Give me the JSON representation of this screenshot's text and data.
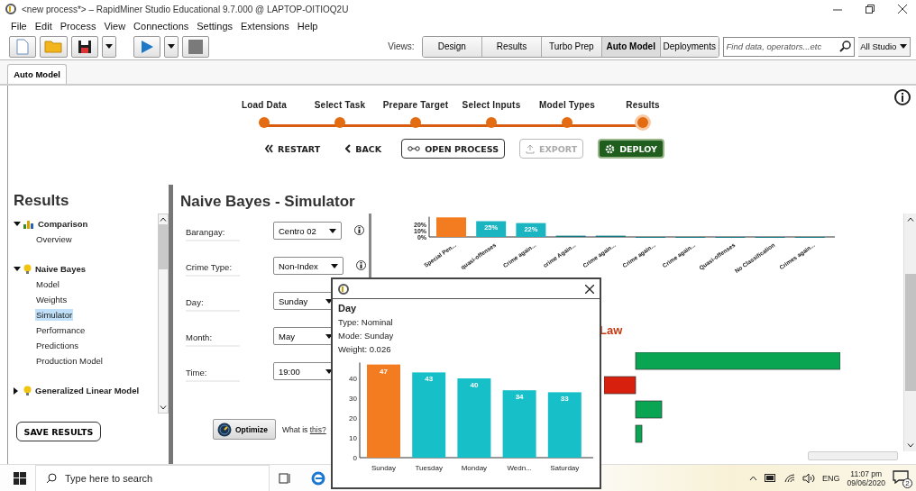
{
  "window": {
    "title": "<new process*> – RapidMiner Studio Educational 9.7.000 @ LAPTOP-OITIOQ2U"
  },
  "menu": [
    "File",
    "Edit",
    "Process",
    "View",
    "Connections",
    "Settings",
    "Extensions",
    "Help"
  ],
  "toolbar": {
    "views_label": "Views:",
    "views": [
      {
        "label": "Design",
        "selected": false
      },
      {
        "label": "Results",
        "selected": false
      },
      {
        "label": "Turbo Prep",
        "selected": false
      },
      {
        "label": "Auto Model",
        "selected": true
      },
      {
        "label": "Deployments",
        "selected": false
      }
    ],
    "search": {
      "placeholder": "Find data, operators...etc"
    },
    "scope": "All Studio"
  },
  "tabs": [
    {
      "label": "Auto Model",
      "selected": true
    }
  ],
  "stepper": {
    "steps": [
      {
        "label": "Load Data",
        "selected": false
      },
      {
        "label": "Select Task",
        "selected": false
      },
      {
        "label": "Prepare Target",
        "selected": false
      },
      {
        "label": "Select Inputs",
        "selected": false
      },
      {
        "label": "Model Types",
        "selected": false
      },
      {
        "label": "Results",
        "selected": true
      }
    ],
    "buttons": [
      {
        "label": "RESTART",
        "kind": "restart",
        "disabled": false
      },
      {
        "label": "BACK",
        "kind": "back",
        "disabled": false
      },
      {
        "label": "OPEN PROCESS",
        "kind": "open",
        "disabled": false
      },
      {
        "label": "EXPORT",
        "kind": "export",
        "disabled": true
      },
      {
        "label": "DEPLOY",
        "kind": "deploy",
        "disabled": false
      }
    ]
  },
  "results": {
    "title": "Results",
    "tree": [
      {
        "label": "Comparison",
        "kind": "comparison",
        "expanded": true,
        "children": [
          {
            "label": "Overview",
            "selected": false
          }
        ]
      },
      {
        "label": "Naive Bayes",
        "kind": "model",
        "expanded": true,
        "children": [
          {
            "label": "Model",
            "selected": false
          },
          {
            "label": "Weights",
            "selected": false
          },
          {
            "label": "Simulator",
            "selected": true
          },
          {
            "label": "Performance",
            "selected": false
          },
          {
            "label": "Predictions",
            "selected": false
          },
          {
            "label": "Production Model",
            "selected": false
          }
        ]
      },
      {
        "label": "Generalized Linear Model",
        "kind": "model",
        "expanded": false
      }
    ],
    "save_button": "SAVE RESULTS"
  },
  "simulator": {
    "title": "Naive Bayes - Simulator",
    "fields": [
      {
        "label": "Barangay:",
        "value": "Centro 02",
        "info": true
      },
      {
        "label": "Crime Type:",
        "value": "Non-Index",
        "info": true
      },
      {
        "label": "Day:",
        "value": "Sunday",
        "info": false
      },
      {
        "label": "Month:",
        "value": "May",
        "info": false
      },
      {
        "label": "Time:",
        "value": "19:00",
        "info": false
      }
    ],
    "optimize": "Optimize",
    "help_text": "What is",
    "help_link": "this?"
  },
  "prediction_chart": {
    "bars": [
      {
        "color": "#f47c20"
      },
      {
        "color": "#1ab5c0"
      },
      {
        "color": "#1ab5c0"
      },
      {
        "color": "#137c85"
      },
      {
        "color": "#137c85"
      },
      {
        "color": "#137c85"
      },
      {
        "color": "#137c85"
      },
      {
        "color": "#137c85"
      },
      {
        "color": "#137c85"
      },
      {
        "color": "#137c85"
      }
    ],
    "chart_data": {
      "type": "bar",
      "categories": [
        "Special Pen...",
        "quasi-offenses",
        "Crime again...",
        "crime Again...",
        "Crime again...",
        "Crime again...",
        "Crime again...",
        "Quasi-offenses",
        "No Classification",
        "Crimes again..."
      ],
      "values": [
        31,
        25,
        22,
        2,
        2,
        0,
        0,
        0,
        0,
        0
      ],
      "ylim": [
        0,
        32
      ],
      "yticks": [
        {
          "value": 0,
          "label": "0%"
        },
        {
          "value": 10,
          "label": "10%"
        },
        {
          "value": 20,
          "label": "20%"
        }
      ],
      "value_labels": [
        null,
        "25%",
        "22%",
        null,
        null,
        null,
        null,
        null,
        null,
        null
      ]
    }
  },
  "weights_panel": {
    "title": "Law"
  },
  "popup": {
    "title": "Day",
    "lines": [
      "Type: Nominal",
      "Mode: Sunday",
      "Weight: 0.026"
    ],
    "bars": [
      {
        "color": "#f47c20"
      },
      {
        "color": "#17bfc9"
      },
      {
        "color": "#17bfc9"
      },
      {
        "color": "#17bfc9"
      },
      {
        "color": "#17bfc9"
      }
    ],
    "chart_data": {
      "type": "bar",
      "categories": [
        "Sunday",
        "Tuesday",
        "Monday",
        "Wedn...",
        "Saturday"
      ],
      "values": [
        47,
        43,
        40,
        34,
        33
      ],
      "ylim": [
        0,
        48
      ],
      "yticks": [
        0,
        10,
        20,
        30,
        40
      ],
      "value_labels": [
        "47",
        "43",
        "40",
        "34",
        "33"
      ]
    }
  },
  "taskbar": {
    "search_placeholder": "Type here to search",
    "language": "ENG",
    "time": "11:07 pm",
    "date": "09/06/2020",
    "notifications": "2"
  }
}
